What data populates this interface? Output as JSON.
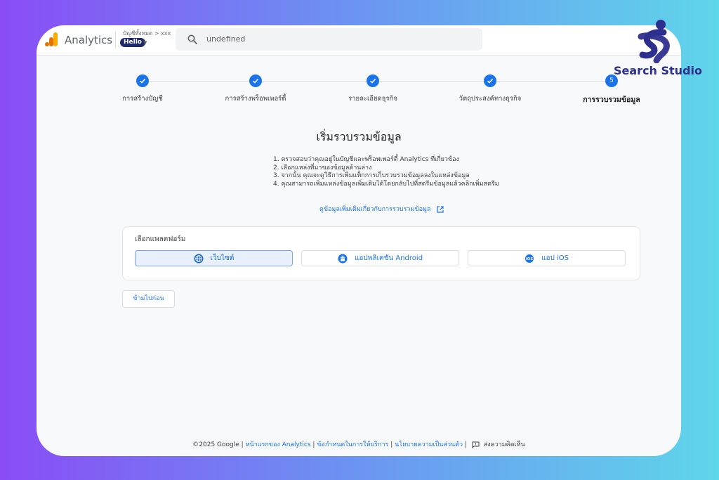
{
  "header": {
    "app_name": "Analytics",
    "account_crumb": "บัญชีทั้งหมด > xxx",
    "property_chip": "Hello",
    "search_value": "undefined"
  },
  "steps": [
    {
      "label": "การสร้างบัญชี",
      "status": "done"
    },
    {
      "label": "การสร้างพร็อพเพอร์ตี้",
      "status": "done"
    },
    {
      "label": "รายละเอียดธุรกิจ",
      "status": "done"
    },
    {
      "label": "วัตถุประสงค์ทางธุรกิจ",
      "status": "done"
    },
    {
      "label": "การรวบรวมข้อมูล",
      "status": "active",
      "number": "5"
    }
  ],
  "main": {
    "title": "เริ่มรวบรวมข้อมูล",
    "instructions": [
      "1. ตรวจสอบว่าคุณอยู่ในบัญชีและพร็อพเพอร์ตี้ Analytics ที่เกี่ยวข้อง",
      "2. เลือกแหล่งที่มาของข้อมูลด้านล่าง",
      "3. จากนั้น คุณจะดูวิธีการเพิ่มแท็กการเก็บรวบรวมข้อมูลลงในแหล่งข้อมูล",
      "4. คุณสามารถเพิ่มแหล่งข้อมูลเพิ่มเติมได้โดยกลับไปที่สตรีมข้อมูลแล้วคลิกเพิ่มสตรีม"
    ],
    "learn_more": "ดูข้อมูลเพิ่มเติมเกี่ยวกับการรวบรวมข้อมูล",
    "platform_title": "เลือกแพลตฟอร์ม",
    "platforms": [
      {
        "label": "เว็บไซต์",
        "icon": "globe-icon",
        "selected": true
      },
      {
        "label": "แอปพลิเคชัน Android",
        "icon": "android-icon",
        "selected": false
      },
      {
        "label": "แอป iOS",
        "icon": "ios-icon",
        "selected": false
      }
    ],
    "skip_label": "ข้ามไปก่อน"
  },
  "footer": {
    "copyright": "©2025 Google |",
    "link_home": "หน้าแรกของ Analytics",
    "sep1": "|",
    "link_terms": "ข้อกำหนดในการให้บริการ",
    "sep2": "|",
    "link_privacy": "นโยบายความเป็นส่วนตัว",
    "sep3": "|",
    "feedback": "ส่งความคิดเห็น"
  },
  "brand": {
    "text": "Search Studio",
    "color": "#2d2f8f"
  },
  "colors": {
    "accent": "#1a73e8",
    "ga_orange": "#f9ab00",
    "ga_dark_orange": "#e37400"
  }
}
